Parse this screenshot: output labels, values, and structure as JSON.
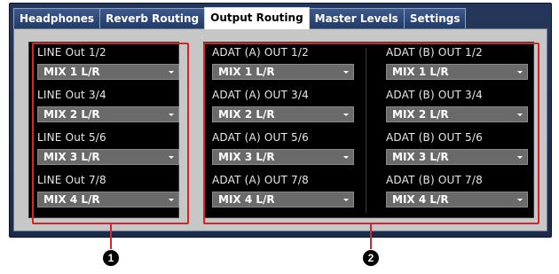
{
  "tabs": [
    {
      "label": "Headphones"
    },
    {
      "label": "Reverb Routing"
    },
    {
      "label": "Output Routing"
    },
    {
      "label": "Master Levels"
    },
    {
      "label": "Settings"
    }
  ],
  "active_tab": "Output Routing",
  "line_outputs": [
    {
      "label": "LINE Out 1/2",
      "value": "MIX 1 L/R"
    },
    {
      "label": "LINE Out 3/4",
      "value": "MIX 2 L/R"
    },
    {
      "label": "LINE Out 5/6",
      "value": "MIX 3 L/R"
    },
    {
      "label": "LINE Out 7/8",
      "value": "MIX 4 L/R"
    }
  ],
  "adat_a_outputs": [
    {
      "label": "ADAT (A) OUT 1/2",
      "value": "MIX 1 L/R"
    },
    {
      "label": "ADAT (A) OUT 3/4",
      "value": "MIX 2 L/R"
    },
    {
      "label": "ADAT (A) OUT 5/6",
      "value": "MIX 3 L/R"
    },
    {
      "label": "ADAT (A) OUT 7/8",
      "value": "MIX 4 L/R"
    }
  ],
  "adat_b_outputs": [
    {
      "label": "ADAT (B) OUT 1/2",
      "value": "MIX 1 L/R"
    },
    {
      "label": "ADAT (B) OUT 3/4",
      "value": "MIX 2 L/R"
    },
    {
      "label": "ADAT (B) OUT 5/6",
      "value": "MIX 3 L/R"
    },
    {
      "label": "ADAT (B) OUT 7/8",
      "value": "MIX 4 L/R"
    }
  ],
  "callouts": [
    {
      "number": "1"
    },
    {
      "number": "2"
    }
  ],
  "colors": {
    "highlight": "#d9232a",
    "panel": "#000000",
    "dropdown": "#6a6a6a"
  }
}
